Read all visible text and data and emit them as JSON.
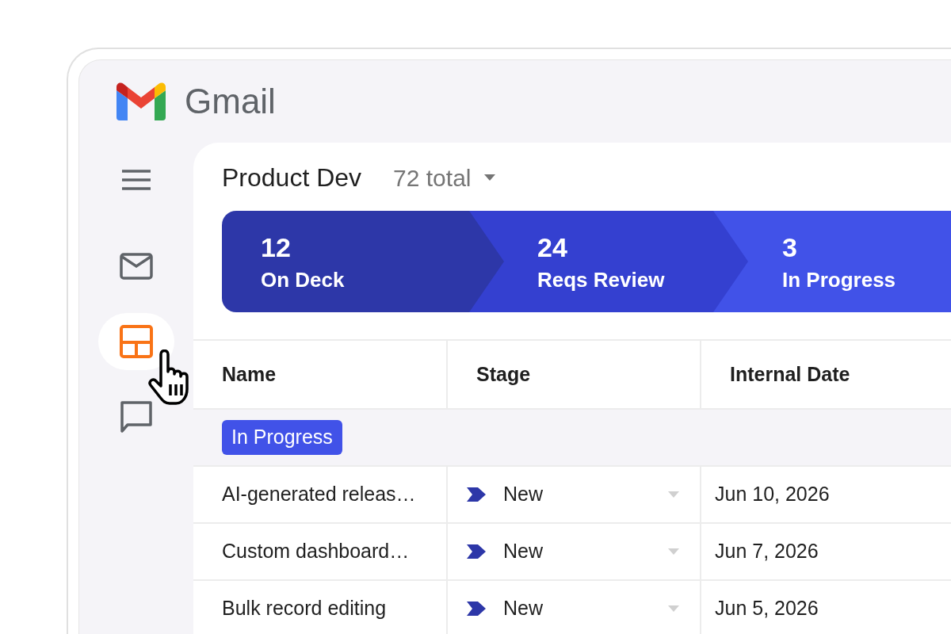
{
  "app": {
    "name": "Gmail"
  },
  "rail": [
    {
      "kind": "menu",
      "selected": false
    },
    {
      "kind": "mail",
      "selected": false
    },
    {
      "kind": "layout",
      "selected": true
    },
    {
      "kind": "chat",
      "selected": false
    }
  ],
  "view": {
    "title": "Product Dev",
    "total": "72 total"
  },
  "pipeline": [
    {
      "count": "12",
      "label": "On Deck"
    },
    {
      "count": "24",
      "label": "Reqs Review"
    },
    {
      "count": "3",
      "label": "In Progress"
    }
  ],
  "table": {
    "columns": [
      "Name",
      "Stage",
      "Internal Date"
    ],
    "groups": [
      {
        "label": "In Progress",
        "rows": [
          {
            "name": "AI-generated releas…",
            "stage": "New",
            "date": "Jun 10, 2026"
          },
          {
            "name": "Custom dashboard…",
            "stage": "New",
            "date": "Jun 7, 2026"
          },
          {
            "name": "Bulk record editing",
            "stage": "New",
            "date": "Jun 5, 2026"
          }
        ]
      }
    ]
  }
}
